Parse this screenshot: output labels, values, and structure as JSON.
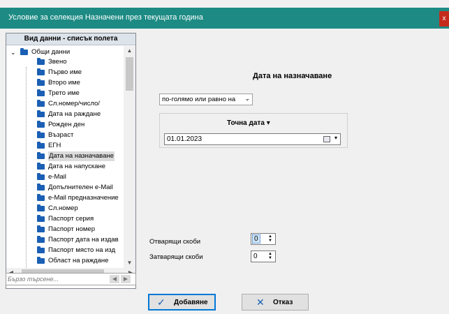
{
  "window": {
    "title": "Условие за селекция Назначени през текущата година",
    "close_glyph": "x"
  },
  "tree": {
    "header": "Вид данни - списък полета",
    "root": "Общи данни",
    "items": [
      {
        "label": "Звено"
      },
      {
        "label": "Първо име"
      },
      {
        "label": "Второ име"
      },
      {
        "label": "Трето име"
      },
      {
        "label": "Сл.номер/число/"
      },
      {
        "label": "Дата на раждане"
      },
      {
        "label": "Рожден ден"
      },
      {
        "label": "Възраст"
      },
      {
        "label": "ЕГН"
      },
      {
        "label": "Дата на назначаване",
        "selected": true
      },
      {
        "label": "Дата на напускане"
      },
      {
        "label": "e-Mail"
      },
      {
        "label": "Допълнителен e-Mail"
      },
      {
        "label": "e-Mail предназначение"
      },
      {
        "label": "Сл.номер"
      },
      {
        "label": "Паспорт серия"
      },
      {
        "label": "Паспорт номер"
      },
      {
        "label": "Паспорт дата на издав"
      },
      {
        "label": "Паспорт място на изд"
      },
      {
        "label": "Област на раждане"
      }
    ],
    "search_placeholder": "Бързо търсене..."
  },
  "condition": {
    "field_title": "Дата на назначаване",
    "operator": "по-голямо или равно на",
    "value_header": "Точна дата",
    "date_value": "01.01.2023"
  },
  "brackets": {
    "open_label": "Отварящи скоби",
    "open_value": "0",
    "close_label": "Затварящи скоби",
    "close_value": "0"
  },
  "buttons": {
    "add_label": "Добавяне",
    "cancel_label": "Отказ"
  },
  "colors": {
    "titlebar": "#1d8b84",
    "folder": "#1a5fb4",
    "focus": "#0078d7"
  }
}
